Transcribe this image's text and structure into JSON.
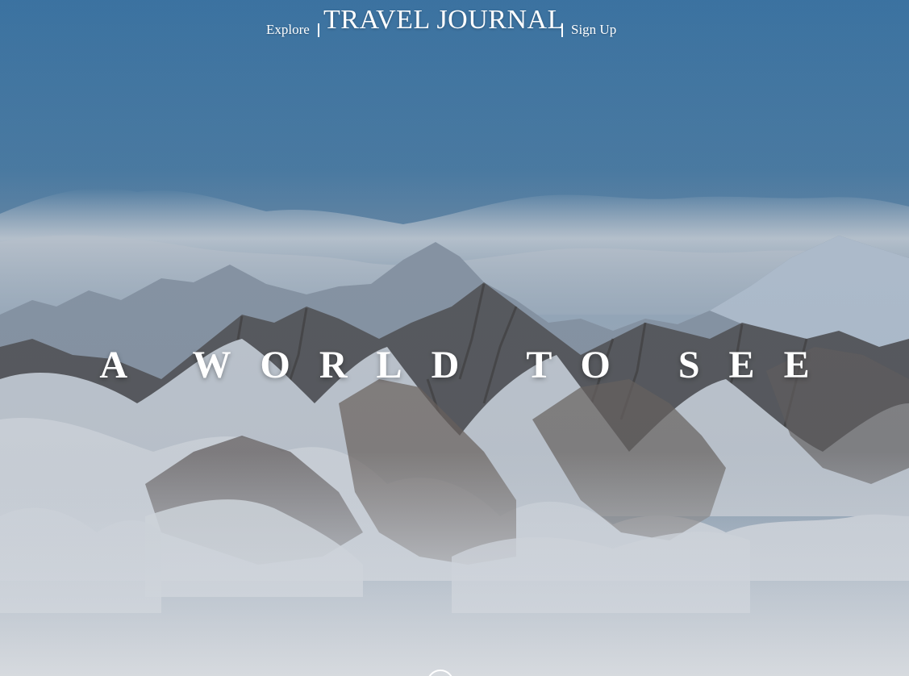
{
  "nav": {
    "explore_label": "Explore",
    "brand_title": "TRAVEL JOURNAL",
    "signup_label": "Sign Up"
  },
  "hero": {
    "headline": "A WORLD TO SEE",
    "background": "snowy-mountain-range-photo",
    "scroll_icon": "scroll-down-circle-icon"
  },
  "colors": {
    "sky_top": "#3f78a8",
    "text": "#ffffff",
    "snow": "#eef2f6"
  }
}
